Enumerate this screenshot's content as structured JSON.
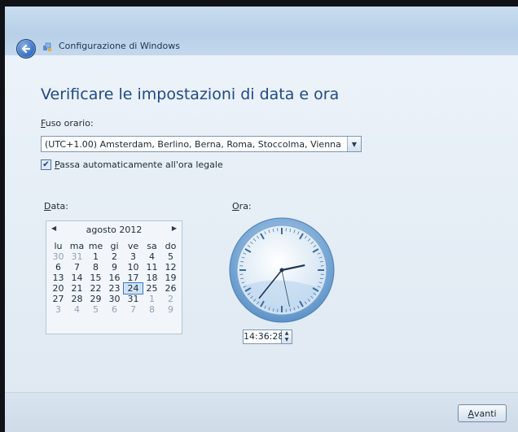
{
  "window": {
    "title": "Configurazione di Windows"
  },
  "page": {
    "heading": "Verificare le impostazioni di data e ora"
  },
  "timezone": {
    "label_accel": "F",
    "label_rest": "uso orario:",
    "selected": "(UTC+1.00) Amsterdam, Berlino, Berna, Roma, Stoccolma, Vienna"
  },
  "dst": {
    "checked": true,
    "label_accel": "P",
    "label_rest": "assa automaticamente all'ora legale"
  },
  "date": {
    "label_accel": "D",
    "label_rest": "ata:"
  },
  "calendar": {
    "month": "agosto 2012",
    "weekdays": [
      "lu",
      "ma",
      "me",
      "gi",
      "ve",
      "sa",
      "do"
    ],
    "selected_day": "24",
    "weeks": [
      [
        {
          "d": "30",
          "dim": true
        },
        {
          "d": "31",
          "dim": true
        },
        {
          "d": "1"
        },
        {
          "d": "2"
        },
        {
          "d": "3"
        },
        {
          "d": "4"
        },
        {
          "d": "5"
        }
      ],
      [
        {
          "d": "6"
        },
        {
          "d": "7"
        },
        {
          "d": "8"
        },
        {
          "d": "9"
        },
        {
          "d": "10"
        },
        {
          "d": "11"
        },
        {
          "d": "12"
        }
      ],
      [
        {
          "d": "13"
        },
        {
          "d": "14"
        },
        {
          "d": "15"
        },
        {
          "d": "16"
        },
        {
          "d": "17"
        },
        {
          "d": "18"
        },
        {
          "d": "19"
        }
      ],
      [
        {
          "d": "20"
        },
        {
          "d": "21"
        },
        {
          "d": "22"
        },
        {
          "d": "23"
        },
        {
          "d": "24",
          "selected": true
        },
        {
          "d": "25"
        },
        {
          "d": "26"
        }
      ],
      [
        {
          "d": "27"
        },
        {
          "d": "28"
        },
        {
          "d": "29"
        },
        {
          "d": "30"
        },
        {
          "d": "31"
        },
        {
          "d": "1",
          "dim": true
        },
        {
          "d": "2",
          "dim": true
        }
      ],
      [
        {
          "d": "3",
          "dim": true
        },
        {
          "d": "4",
          "dim": true
        },
        {
          "d": "5",
          "dim": true
        },
        {
          "d": "6",
          "dim": true
        },
        {
          "d": "7",
          "dim": true
        },
        {
          "d": "8",
          "dim": true
        },
        {
          "d": "9",
          "dim": true
        }
      ]
    ]
  },
  "time": {
    "label_accel": "O",
    "label_rest": "ra:",
    "value": "14:36:28",
    "hours": 14,
    "minutes": 36,
    "seconds": 28
  },
  "footer": {
    "next_accel": "A",
    "next_rest": "vanti"
  },
  "icons": {
    "back": "back-arrow-icon",
    "app": "windows-setup-icon",
    "dropdown": "chevron-down-icon",
    "spin": "spin-arrows-icon"
  },
  "colors": {
    "heading": "#1f4a86",
    "accent": "#3d78c8"
  }
}
